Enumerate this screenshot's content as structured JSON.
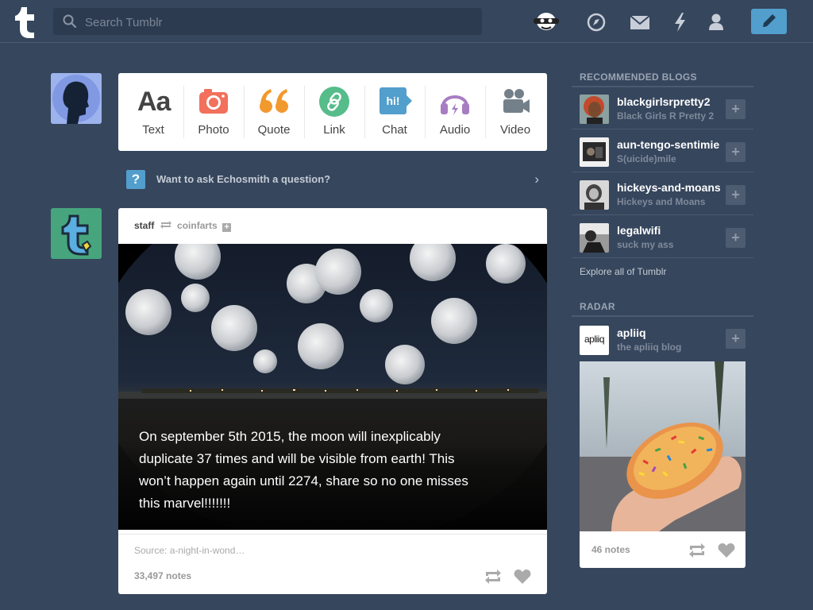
{
  "header": {
    "search_placeholder": "Search Tumblr",
    "icons": [
      "tumblr-logo-icon",
      "search-icon",
      "avatar-face-icon",
      "compass-icon",
      "mail-icon",
      "lightning-icon",
      "person-icon",
      "pencil-icon"
    ]
  },
  "post_bar": {
    "items": [
      {
        "label": "Text",
        "icon": "text-icon"
      },
      {
        "label": "Photo",
        "icon": "camera-icon"
      },
      {
        "label": "Quote",
        "icon": "quote-icon"
      },
      {
        "label": "Link",
        "icon": "link-icon"
      },
      {
        "label": "Chat",
        "icon": "chat-icon",
        "glyph": "hi!"
      },
      {
        "label": "Audio",
        "icon": "headphones-icon"
      },
      {
        "label": "Video",
        "icon": "video-camera-icon"
      }
    ],
    "text_glyph": "Aa",
    "quote_glyph": "66",
    "colors": {
      "text": "#444444",
      "photo": "#f2705c",
      "quote": "#f2992e",
      "link": "#56bc8a",
      "chat": "#529ecc",
      "audio": "#a77dc2",
      "video": "#748089"
    }
  },
  "ask": {
    "icon_glyph": "?",
    "text": "Want to ask Echosmith a question?",
    "chevron": "›"
  },
  "post": {
    "author": "staff",
    "reblogged_from": "coinfarts",
    "caption": "On september 5th 2015, the moon will inexplicably duplicate 37 times and will be visible from earth! This won’t happen again until 2274, share so no one misses this marvel!!!!!!!",
    "source": "Source: a-night-in-wond…",
    "notes": "33,497 notes"
  },
  "sidebar": {
    "recommended_title": "RECOMMENDED BLOGS",
    "blogs": [
      {
        "name": "blackgirlsrpretty2",
        "subtitle": "Black Girls R Pretty 2",
        "plus": "+"
      },
      {
        "name": "aun-tengo-sentimientos",
        "subtitle": "S(uicide)mile",
        "plus": "+"
      },
      {
        "name": "hickeys-and-moans",
        "subtitle": "Hickeys and Moans",
        "plus": "+"
      },
      {
        "name": "legalwifi",
        "subtitle": "suck my ass",
        "plus": "+"
      }
    ],
    "explore": "Explore all of Tumblr",
    "radar_title": "RADAR",
    "radar": {
      "name": "apliiq",
      "subtitle": "the apliiq blog",
      "plus": "+",
      "logo_text": "apliiq",
      "notes": "46 notes"
    }
  },
  "colors": {
    "background": "#36465d",
    "accent": "#529ecc",
    "card": "#ffffff"
  }
}
